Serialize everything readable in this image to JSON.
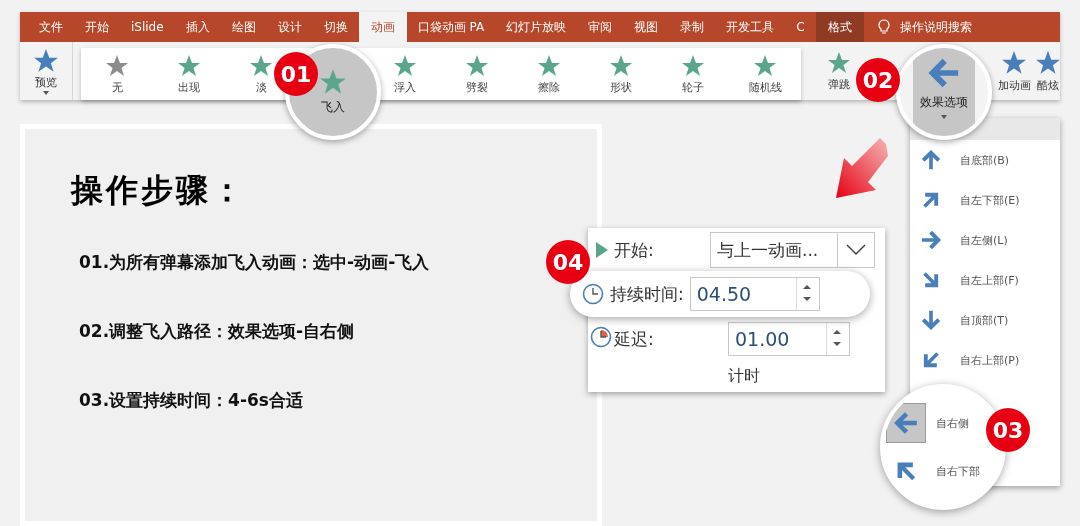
{
  "ribbon": {
    "tabs": [
      {
        "label": "文件",
        "selected": false,
        "contextual": false
      },
      {
        "label": "开始",
        "selected": false,
        "contextual": false
      },
      {
        "label": "iSlide",
        "selected": false,
        "contextual": false
      },
      {
        "label": "插入",
        "selected": false,
        "contextual": false
      },
      {
        "label": "绘图",
        "selected": false,
        "contextual": false
      },
      {
        "label": "设计",
        "selected": false,
        "contextual": false
      },
      {
        "label": "切换",
        "selected": false,
        "contextual": false
      },
      {
        "label": "动画",
        "selected": true,
        "contextual": false
      },
      {
        "label": "口袋动画 PA",
        "selected": false,
        "contextual": false
      },
      {
        "label": "幻灯片放映",
        "selected": false,
        "contextual": false
      },
      {
        "label": "审阅",
        "selected": false,
        "contextual": false
      },
      {
        "label": "视图",
        "selected": false,
        "contextual": false
      },
      {
        "label": "录制",
        "selected": false,
        "contextual": false
      },
      {
        "label": "开发工具",
        "selected": false,
        "contextual": false
      },
      {
        "label": "C",
        "selected": false,
        "contextual": false
      },
      {
        "label": "格式",
        "selected": false,
        "contextual": true
      }
    ],
    "search_hint": "操作说明搜索",
    "preview": "预览",
    "gallery": [
      {
        "label": "无",
        "kind": "none",
        "selected": false
      },
      {
        "label": "出现",
        "kind": "effect",
        "selected": false
      },
      {
        "label": "淡",
        "kind": "effect",
        "selected": false
      },
      {
        "label": "飞入",
        "kind": "effect",
        "selected": true
      },
      {
        "label": "浮入",
        "kind": "effect",
        "selected": false
      },
      {
        "label": "劈裂",
        "kind": "effect",
        "selected": false
      },
      {
        "label": "擦除",
        "kind": "effect",
        "selected": false
      },
      {
        "label": "形状",
        "kind": "effect",
        "selected": false
      },
      {
        "label": "轮子",
        "kind": "effect",
        "selected": false
      },
      {
        "label": "随机线",
        "kind": "effect",
        "selected": false
      }
    ],
    "bounce": "弹跳",
    "effect_options": "效果选项",
    "add_animation": "加动画",
    "cool": "酷炫"
  },
  "steps_card": {
    "title": "操作步骤：",
    "steps": [
      "01.为所有弹幕添加飞入动画：选中-动画-飞入",
      "02.调整飞入路径：效果选项-自右侧",
      "03.设置持续时间：4-6s合适"
    ]
  },
  "timing_panel": {
    "start_label": "开始:",
    "start_value": "与上一动画...",
    "duration_label": "持续时间:",
    "duration_value": "04.50",
    "delay_label": "延迟:",
    "delay_value": "01.00",
    "group_label": "计时"
  },
  "direction_menu": {
    "items": [
      {
        "label": "自底部(B)",
        "kind": "up"
      },
      {
        "label": "自左下部(E)",
        "kind": "upright"
      },
      {
        "label": "自左侧(L)",
        "kind": "right"
      },
      {
        "label": "自左上部(F)",
        "kind": "downright"
      },
      {
        "label": "自顶部(T)",
        "kind": "down"
      },
      {
        "label": "自右上部(P)",
        "kind": "downleft"
      }
    ],
    "magnified": [
      {
        "label": "自右侧",
        "kind": "left",
        "selected": true
      },
      {
        "label": "自右下部",
        "kind": "upleft",
        "selected": false
      }
    ]
  },
  "badges": [
    "01",
    "02",
    "03",
    "04"
  ]
}
